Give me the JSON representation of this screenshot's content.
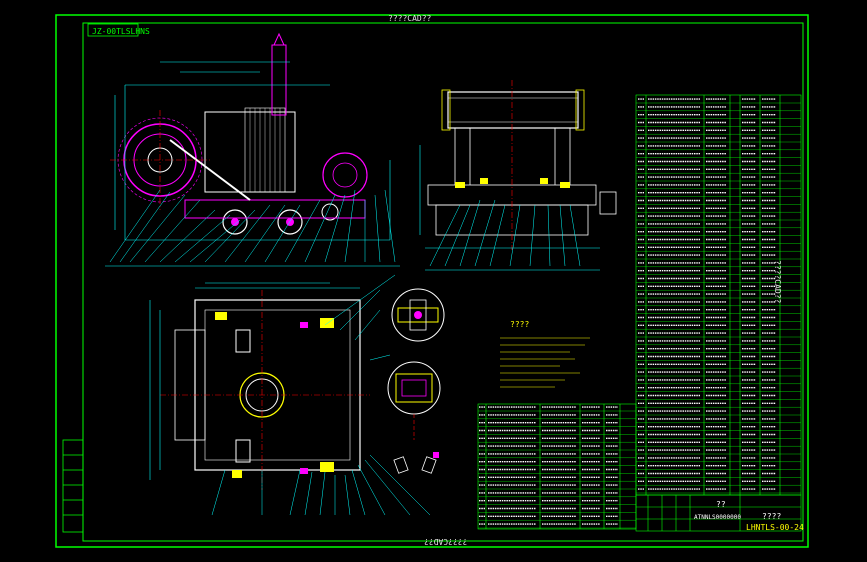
{
  "drawing": {
    "title_top": "????CAD??",
    "title_bottom": "????CAD??",
    "title_side": "????CAD??",
    "reference_code": "JZ-00TLSLHNS",
    "technical_note_title": "????",
    "title_block": {
      "label_1": "??",
      "label_2": "????",
      "drawing_number": "LHNTLS-00-24",
      "sub_code": "ATNNLS0000000"
    }
  },
  "colors": {
    "background": "#000000",
    "frame": "#00ff00",
    "cad_cyan": "#00ffff",
    "cad_magenta": "#ff00ff",
    "cad_yellow": "#ffff00",
    "cad_red": "#ff0000",
    "cad_white": "#ffffff",
    "cad_blue": "#3a6bff"
  }
}
